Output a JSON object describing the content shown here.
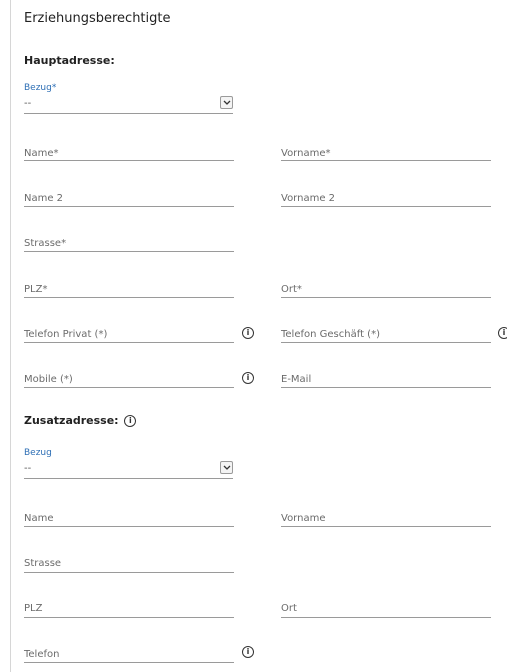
{
  "page_title": "Erziehungsberechtigte",
  "haupt": {
    "section_title": "Hauptadresse:",
    "bezug_label": "Bezug*",
    "bezug_value": "--",
    "name": "Name*",
    "vorname": "Vorname*",
    "name2": "Name 2",
    "vorname2": "Vorname 2",
    "strasse": "Strasse*",
    "plz": "PLZ*",
    "ort": "Ort*",
    "telefon_privat": "Telefon Privat (*)",
    "telefon_geschaeft": "Telefon Geschäft (*)",
    "mobile": "Mobile (*)",
    "email": "E-Mail"
  },
  "zusatz": {
    "section_title": "Zusatzadresse:",
    "bezug_label": "Bezug",
    "bezug_value": "--",
    "name": "Name",
    "vorname": "Vorname",
    "strasse": "Strasse",
    "plz": "PLZ",
    "ort": "Ort",
    "telefon": "Telefon"
  },
  "icons": {
    "info_glyph": "i"
  },
  "colors": {
    "accent_label": "#2e6fb5",
    "field_label": "#6b6b6b",
    "underline": "#9a9a9a"
  }
}
